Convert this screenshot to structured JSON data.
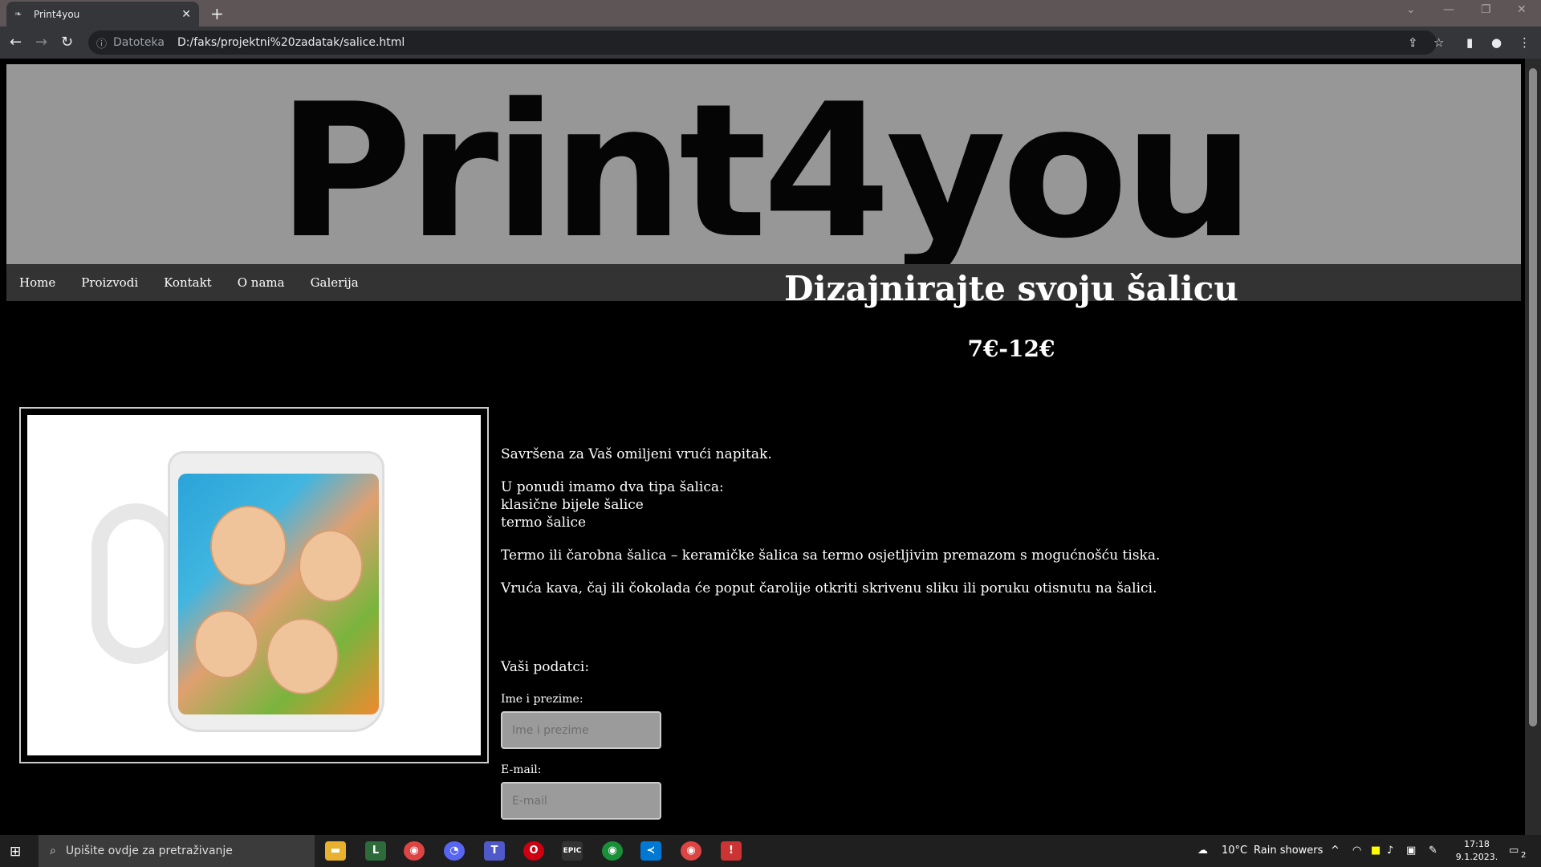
{
  "browser": {
    "tab_title": "Print4you",
    "new_tab_icon": "+",
    "close_icon": "✕",
    "address_scheme": "Datoteka",
    "address_url": "D:/faks/projektni%20zadatak/salice.html"
  },
  "site": {
    "logo": "Print4you",
    "nav": [
      "Home",
      "Proizvodi",
      "Kontakt",
      "O nama",
      "Galerija"
    ]
  },
  "product": {
    "heading": "Dizajnirajte svoju šalicu",
    "price": "7€-12€",
    "desc1": "Savršena za Vaš omiljeni vrući napitak.",
    "types_intro": "U ponudi imamo dva tipa šalica:",
    "type1": "klasične bijele šalice",
    "type2": "termo šalice",
    "desc2": "Termo ili čarobna šalica – keramičke šalica sa termo osjetljivim premazom s mogućnošću tiska.",
    "desc3": "Vruća kava, čaj ili čokolada će poput čarolije otkriti skrivenu sliku ili poruku otisnutu na šalici."
  },
  "form": {
    "title": "Vaši podatci:",
    "name_label": "Ime i prezime:",
    "name_placeholder": "Ime i prezime",
    "email_label": "E-mail:",
    "email_placeholder": "E-mail"
  },
  "taskbar": {
    "search_placeholder": "Upišite ovdje za pretraživanje",
    "weather_temp": "10°C",
    "weather_text": "Rain showers",
    "time": "17:18",
    "date": "9.1.2023.",
    "notification_count": "2"
  }
}
